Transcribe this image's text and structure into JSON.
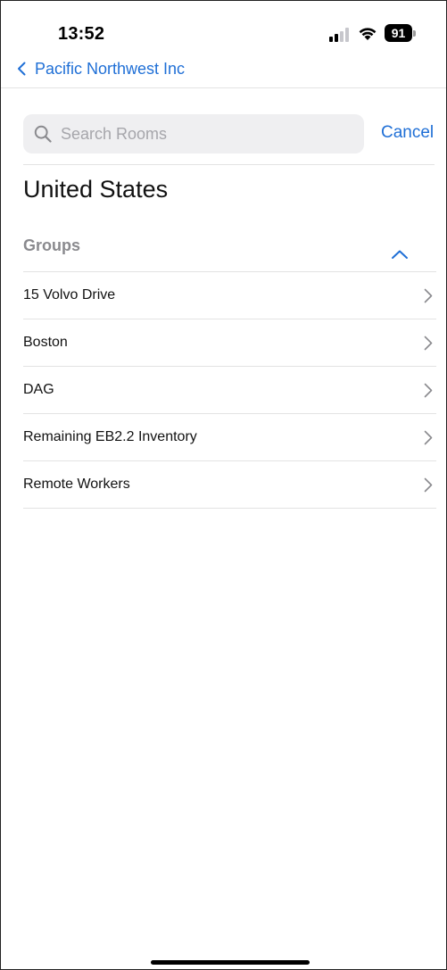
{
  "status_bar": {
    "time": "13:52",
    "battery_level": "91",
    "signal_icon": "cellular-signal-icon",
    "wifi_icon": "wifi-icon"
  },
  "nav": {
    "back_label": "Pacific Northwest Inc",
    "back_icon": "chevron-left-icon"
  },
  "search": {
    "placeholder": "Search Rooms",
    "value": "",
    "cancel_label": "Cancel"
  },
  "region_title": "United States",
  "groups": {
    "header": "Groups",
    "collapse_icon": "chevron-up-icon",
    "items": [
      {
        "label": "15 Volvo Drive"
      },
      {
        "label": "Boston"
      },
      {
        "label": "DAG"
      },
      {
        "label": "Remaining EB2.2 Inventory"
      },
      {
        "label": "Remote Workers"
      }
    ]
  },
  "colors": {
    "accent": "#1f6fd6",
    "secondary_text": "#8a8a8e",
    "search_background": "#efeff1",
    "divider": "#e3e3e3"
  }
}
